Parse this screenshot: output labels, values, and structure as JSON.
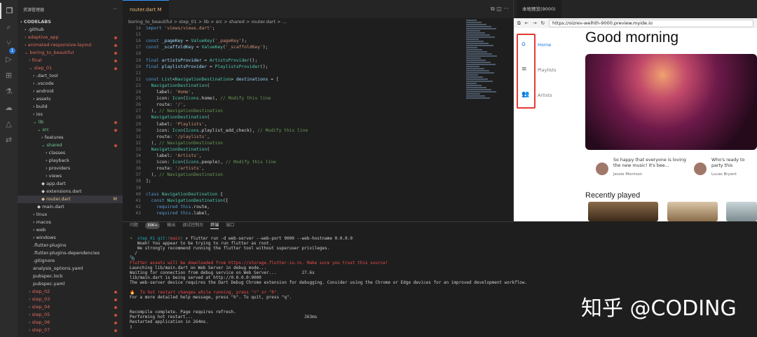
{
  "activity": {
    "items": [
      "files-icon",
      "search-icon",
      "source-control-icon",
      "run-debug-icon",
      "extensions-icon",
      "testing-icon",
      "deploy-icon",
      "remote-icon",
      "live-share-icon"
    ],
    "badge": "1"
  },
  "explorer": {
    "header": "资源管理器",
    "more": "···",
    "tree": [
      {
        "d": 0,
        "t": "CODELABS",
        "b": 1
      },
      {
        "d": 1,
        "t": ".github"
      },
      {
        "d": 1,
        "t": "adaptive_app",
        "r": 1,
        "m": 1
      },
      {
        "d": 1,
        "t": "animated-responsive-layout",
        "r": 1,
        "m": 1
      },
      {
        "d": 1,
        "t": "boring_to_beautiful",
        "r": 1,
        "m": 1,
        "o": 1
      },
      {
        "d": 2,
        "t": "final",
        "r": 1,
        "m": 1
      },
      {
        "d": 2,
        "t": "step_01",
        "r": 1,
        "m": 1,
        "o": 1
      },
      {
        "d": 3,
        "t": ".dart_tool"
      },
      {
        "d": 3,
        "t": ".vscode"
      },
      {
        "d": 3,
        "t": "android"
      },
      {
        "d": 3,
        "t": "assets"
      },
      {
        "d": 3,
        "t": "build"
      },
      {
        "d": 3,
        "t": "ios"
      },
      {
        "d": 3,
        "t": "lib",
        "g": 1,
        "m": 1,
        "o": 1
      },
      {
        "d": 4,
        "t": "src",
        "g": 1,
        "m": 1,
        "o": 1
      },
      {
        "d": 5,
        "t": "features"
      },
      {
        "d": 5,
        "t": "shared",
        "g": 1,
        "m": 1,
        "o": 1
      },
      {
        "d": 6,
        "t": "classes"
      },
      {
        "d": 6,
        "t": "playback"
      },
      {
        "d": 6,
        "t": "providers"
      },
      {
        "d": 6,
        "t": "views"
      },
      {
        "d": 5,
        "t": "app.dart",
        "f": 1
      },
      {
        "d": 5,
        "t": "extensions.dart",
        "f": 1
      },
      {
        "d": 5,
        "t": "router.dart",
        "f": 1,
        "s": 1,
        "mk": "M"
      },
      {
        "d": 4,
        "t": "main.dart",
        "f": 1
      },
      {
        "d": 3,
        "t": "linux"
      },
      {
        "d": 3,
        "t": "macos"
      },
      {
        "d": 3,
        "t": "web"
      },
      {
        "d": 3,
        "t": "windows"
      },
      {
        "d": 3,
        "t": ".flutter-plugins",
        "n": 1
      },
      {
        "d": 3,
        "t": ".flutter-plugins-dependencies",
        "n": 1
      },
      {
        "d": 3,
        "t": ".gitignore",
        "n": 1
      },
      {
        "d": 3,
        "t": "analysis_options.yaml",
        "n": 1
      },
      {
        "d": 3,
        "t": "pubspec.lock",
        "n": 1
      },
      {
        "d": 3,
        "t": "pubspec.yaml",
        "n": 1
      },
      {
        "d": 2,
        "t": "step_02",
        "r": 1,
        "m": 1
      },
      {
        "d": 2,
        "t": "step_03",
        "r": 1,
        "m": 1
      },
      {
        "d": 2,
        "t": "step_04",
        "r": 1,
        "m": 1
      },
      {
        "d": 2,
        "t": "step_05",
        "r": 1,
        "m": 1
      },
      {
        "d": 2,
        "t": "step_06",
        "r": 1,
        "m": 1
      },
      {
        "d": 2,
        "t": "step_07",
        "r": 1,
        "m": 1
      }
    ]
  },
  "editor": {
    "tab": "router.dart",
    "tab_mark": "M",
    "breadcrumb": "boring_to_beautiful  >  step_01  >  lib  >  src  >  shared  >  router.dart  >  ...",
    "lines": [
      [
        14,
        "<span class='k'>import</span> <span class='s'>'views/views.dart'</span>;"
      ],
      [
        15,
        ""
      ],
      [
        16,
        "<span class='k'>const</span> <span class='v'>_pageKey</span> = <span class='t'>ValueKey</span>(<span class='s'>'_pageKey'</span>);"
      ],
      [
        17,
        "<span class='k'>const</span> <span class='v'>_scaffoldKey</span> = <span class='t'>ValueKey</span>(<span class='s'>'_scaffoldKey'</span>);"
      ],
      [
        18,
        ""
      ],
      [
        19,
        "<span class='k'>final</span> <span class='v'>artistsProvider</span> = <span class='t'>ArtistsProvider</span>();"
      ],
      [
        20,
        "<span class='k'>final</span> <span class='v'>playlistsProvider</span> = <span class='t'>PlaylistsProvider</span>();"
      ],
      [
        21,
        ""
      ],
      [
        22,
        "<span class='k'>const</span> <span class='t'>List</span>&lt;<span class='t'>NavigationDestination</span>&gt; <span class='v'>destinations</span> = ["
      ],
      [
        23,
        "  <span class='t'>NavigationDestination</span>("
      ],
      [
        24,
        "    label: <span class='s'>'Home'</span>,"
      ],
      [
        25,
        "    icon: <span class='t'>Icon</span>(<span class='t'>Icons</span>.home), <span class='c'>// Modify this line</span>"
      ],
      [
        26,
        "    route: <span class='s'>'/'</span>,"
      ],
      [
        27,
        "  ), <span class='c'>// NavigationDestination</span>"
      ],
      [
        28,
        "  <span class='t'>NavigationDestination</span>("
      ],
      [
        29,
        "    label: <span class='s'>'Playlists'</span>,"
      ],
      [
        30,
        "    icon: <span class='t'>Icon</span>(<span class='t'>Icons</span>.playlist_add_check), <span class='c'>// Modify this line</span>"
      ],
      [
        31,
        "    route: <span class='s'>'/playlists'</span>,"
      ],
      [
        32,
        "  ), <span class='c'>// NavigationDestination</span>"
      ],
      [
        33,
        "  <span class='t'>NavigationDestination</span>("
      ],
      [
        34,
        "    label: <span class='s'>'Artists'</span>,"
      ],
      [
        35,
        "    icon: <span class='t'>Icon</span>(<span class='t'>Icons</span>.people), <span class='c'>// Modify this line</span>"
      ],
      [
        36,
        "    route: <span class='s'>'/artists'</span>,"
      ],
      [
        37,
        "  ), <span class='c'>// NavigationDestination</span>"
      ],
      [
        38,
        "];"
      ],
      [
        39,
        ""
      ],
      [
        40,
        "<span class='k'>class</span> <span class='t'>NavigationDestination</span> {"
      ],
      [
        41,
        "  <span class='k'>const</span> <span class='t'>NavigationDestination</span>({"
      ],
      [
        42,
        "    <span class='k'>required</span> <span class='k'>this</span>.route,"
      ],
      [
        43,
        "    <span class='k'>required</span> <span class='k'>this</span>.label,"
      ]
    ]
  },
  "panel": {
    "tabs": [
      "问题",
      "输出",
      "调试控制台",
      "终端",
      "端口"
    ],
    "badge": "30K+",
    "terminal": [
      "<span class='gr'>➜</span>  <span class='cy'>step_01 git:(</span><span class='rd'>main</span><span class='cy'>)</span> ✗ flutter run -d web-server --web-port 9000 --web-hostname 0.0.0.0",
      "   Woah! You appear to be trying to run flutter as root.",
      "   We strongly recommend running the flutter tool without superuser privileges.",
      "  /",
      "📎",
      "<span class='rd'>Flutter assets will be downloaded from https://storage.flutter-io.cn. Make sure you trust this source!</span>",
      "Launching lib/main.dart on Web Server in debug mode...",
      "Waiting for connection from debug service on Web Server...          27.6s",
      "lib/main.dart is being served at http://0.0.0.0:9000",
      "The web-server device requires the Dart Debug Chrome extension for debugging. Consider using the Chrome or Edge devices for an improved development workflow.",
      "",
      "🔥  <span class='rd'>To hot restart changes while running, press \"r\" or \"R\".</span>",
      "For a more detailed help message, press \"h\". To quit, press \"q\".",
      "",
      "",
      "Recompile complete. Page requires refresh.",
      "Performing hot restart...                                            263ms",
      "Restarted application in 264ms.",
      "▯"
    ]
  },
  "preview": {
    "tab": "本地预览(9000)",
    "url": "https://oizrev-welhth-9000.preview.myide.io",
    "nav": [
      {
        "icon": "⌂",
        "label": "Home"
      },
      {
        "icon": "≡",
        "label": "Playlists"
      },
      {
        "icon": "👥",
        "label": "Artists"
      }
    ],
    "title": "Good morning",
    "cards": [
      {
        "text": "So happy that everyone is loving the new music! It's bee...",
        "name": "Jessie Morrison"
      },
      {
        "text": "Who's ready to party this weekend?! See you th...",
        "name": "Lucas Bryant"
      }
    ],
    "recent": "Recently played"
  },
  "watermark": "知乎 @CODING"
}
